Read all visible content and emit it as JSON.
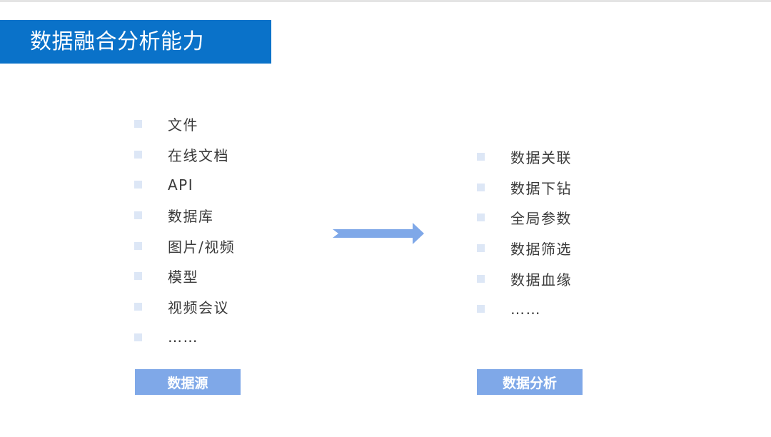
{
  "title": "数据融合分析能力",
  "sources": {
    "items": [
      "文件",
      "在线文档",
      "API",
      "数据库",
      "图片/视频",
      "模型",
      "视频会议",
      "……"
    ],
    "tag": "数据源"
  },
  "analysis": {
    "items": [
      "数据关联",
      "数据下钻",
      "全局参数",
      "数据筛选",
      "数据血缘",
      "……"
    ],
    "tag": "数据分析"
  },
  "colors": {
    "title_bar": "#0a72c9",
    "tag": "#7fa8e8",
    "arrow": "#7fa8e8",
    "bullet": "#dde7f6"
  }
}
